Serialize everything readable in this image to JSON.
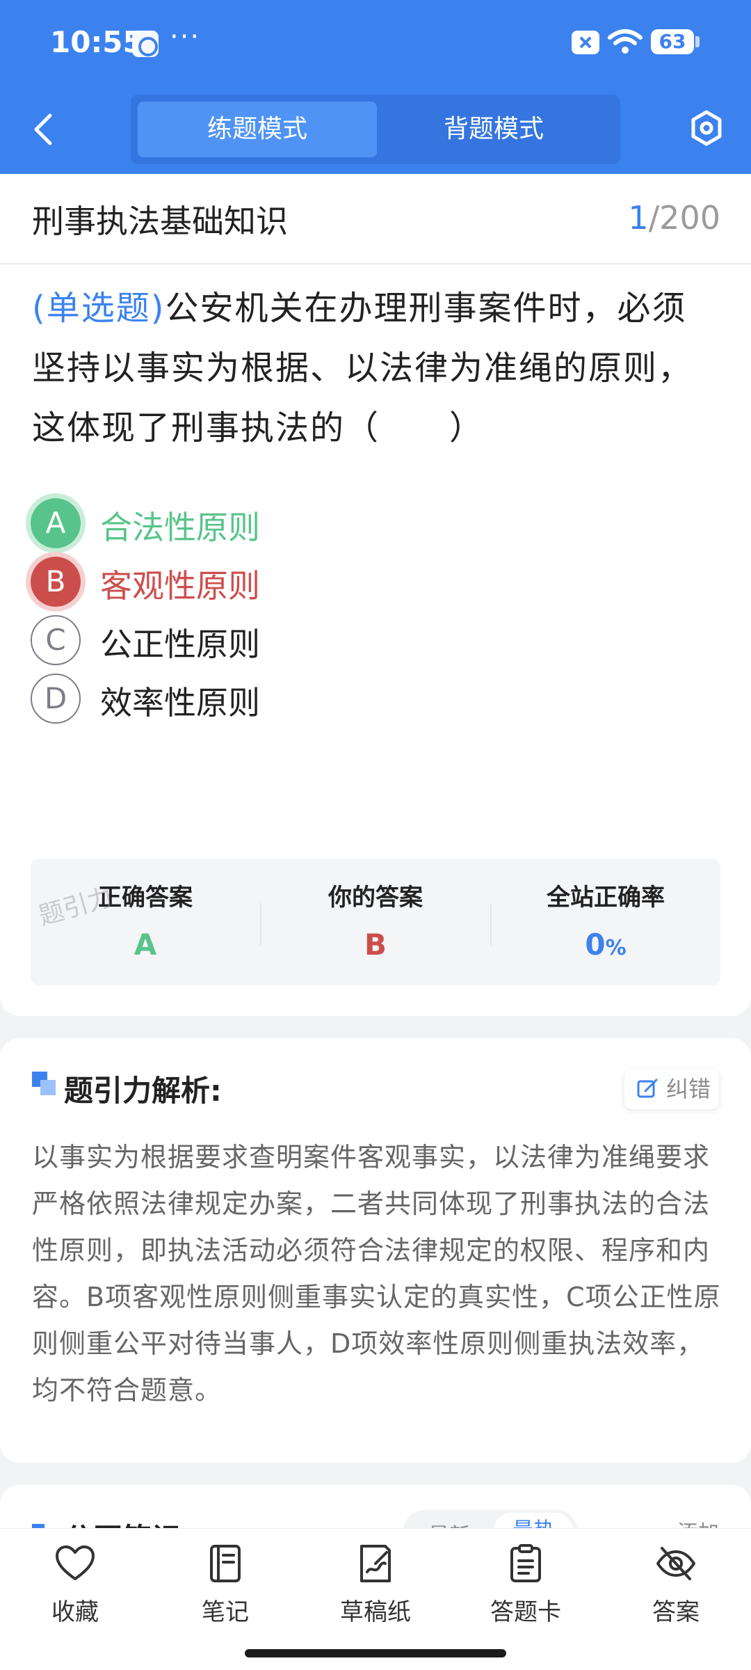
{
  "status_bar": {
    "time": "10:55",
    "dots": "···",
    "battery": "63"
  },
  "header": {
    "tabs": [
      {
        "label": "练题模式",
        "active": true
      },
      {
        "label": "背题模式",
        "active": false
      }
    ],
    "back_icon": "chevron-left-icon",
    "settings_icon": "hexagon-settings-icon"
  },
  "question": {
    "subject": "刑事执法基础知识",
    "current": "1",
    "total": "/200",
    "type_label": "(单选题)",
    "text": "公安机关在办理刑事案件时，必须坚持以事实为根据、以法律为准绳的原则，这体现了刑事执法的（　　）",
    "options": [
      {
        "letter": "A",
        "text": "合法性原则",
        "state": "correct"
      },
      {
        "letter": "B",
        "text": "客观性原则",
        "state": "wrong"
      },
      {
        "letter": "C",
        "text": "公正性原则",
        "state": "normal"
      },
      {
        "letter": "D",
        "text": "效率性原则",
        "state": "normal"
      }
    ]
  },
  "answer_summary": {
    "correct_label": "正确答案",
    "correct_value": "A",
    "yours_label": "你的答案",
    "yours_value": "B",
    "rate_label": "全站正确率",
    "rate_value": "0",
    "rate_unit": "%",
    "watermark": "题引力"
  },
  "analysis": {
    "title": "题引力解析:",
    "fix_label": "纠错",
    "text": "以事实为根据要求查明案件客观事实，以法律为准绳要求严格依照法律规定办案，二者共同体现了刑事执法的合法性原则，即执法活动必须符合法律规定的权限、程序和内容。B项客观性原则侧重事实认定的真实性，C项公正性原则侧重公平对待当事人，D项效率性原则侧重执法效率，均不符合题意。"
  },
  "notes": {
    "title": "公开笔记:",
    "sort_latest": "最新",
    "sort_hot": "最热",
    "add_label": "添加"
  },
  "bottom_nav": [
    {
      "label": "收藏",
      "icon": "heart-icon"
    },
    {
      "label": "笔记",
      "icon": "notebook-icon"
    },
    {
      "label": "草稿纸",
      "icon": "draft-paper-icon"
    },
    {
      "label": "答题卡",
      "icon": "clipboard-icon"
    },
    {
      "label": "答案",
      "icon": "eye-off-icon"
    }
  ],
  "colors": {
    "brand": "#3c82ef",
    "correct": "#58c48b",
    "wrong": "#cc4e4c"
  }
}
